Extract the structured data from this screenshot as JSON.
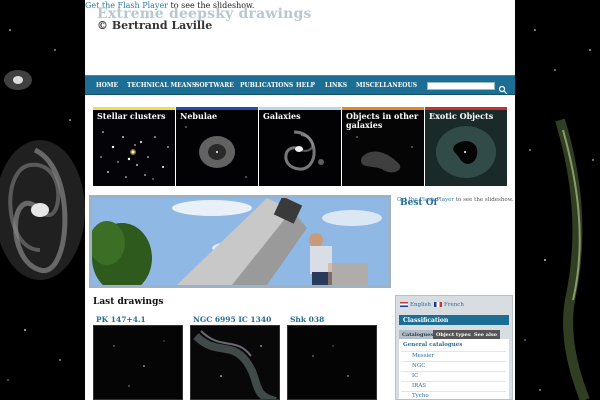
{
  "flash_notice": {
    "link": "Get the Flash Player",
    "text": "to see the slideshow."
  },
  "site": {
    "title": "Extreme deepsky drawings",
    "author": "© Bertrand Laville"
  },
  "nav": {
    "items": [
      "HOME",
      "TECHNICAL MEANS",
      "SOFTWARE",
      "PUBLICATIONS",
      "HELP",
      "LINKS",
      "MISCELLANEOUS"
    ],
    "search_placeholder": "",
    "search_icon": "search-icon"
  },
  "categories": [
    {
      "label": "Stellar clusters",
      "color": "#f0e040"
    },
    {
      "label": "Nebulae",
      "color": "#1f4ea8"
    },
    {
      "label": "Galaxies",
      "color": "#b8d8ea"
    },
    {
      "label": "Objects in other galaxies",
      "color": "#e08a20"
    },
    {
      "label": "Exotic Objects",
      "color": "#c63030"
    }
  ],
  "best_of": {
    "flash_link": "Get the Flash Player",
    "flash_text": "to see the slideshow.",
    "title": "Best Of"
  },
  "last_drawings": {
    "title": "Last drawings",
    "items": [
      "PK 147+4.1",
      "NGC 6995 IC 1340",
      "Shk 038"
    ]
  },
  "sidebar": {
    "languages": [
      "English",
      "French"
    ],
    "classification_title": "Classification",
    "tabs": [
      "Catalogues",
      "Object types",
      "See also"
    ],
    "tree_root": "General catalogues",
    "tree_items": [
      "Messier",
      "NGC",
      "IC",
      "IRAS",
      "Tycho"
    ]
  }
}
